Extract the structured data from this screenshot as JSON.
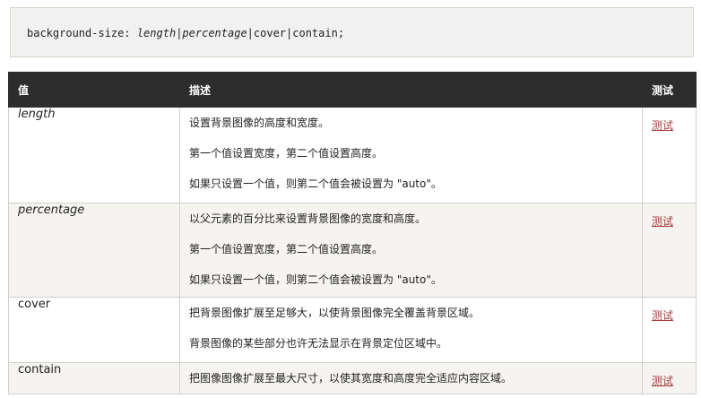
{
  "code": {
    "prefix": "background-size: ",
    "opt1": "length",
    "sep1": "|",
    "opt2": "percentage",
    "rest": "|cover|contain;"
  },
  "table": {
    "headers": [
      "值",
      "描述",
      "测试"
    ],
    "rows": [
      {
        "value": "length",
        "desc": [
          "设置背景图像的高度和宽度。",
          "第一个值设置宽度，第二个值设置高度。",
          "如果只设置一个值，则第二个值会被设置为 \"auto\"。"
        ],
        "test": "测试"
      },
      {
        "value": "percentage",
        "desc": [
          "以父元素的百分比来设置背景图像的宽度和高度。",
          "第一个值设置宽度，第二个值设置高度。",
          "如果只设置一个值，则第二个值会被设置为 \"auto\"。"
        ],
        "test": "测试"
      },
      {
        "value": "cover",
        "desc": [
          "把背景图像扩展至足够大，以使背景图像完全覆盖背景区域。",
          "背景图像的某些部分也许无法显示在背景定位区域中。"
        ],
        "test": "测试"
      },
      {
        "value": "contain",
        "desc": [
          "把图像图像扩展至最大尺寸，以使其宽度和高度完全适应内容区域。"
        ],
        "test": "测试"
      }
    ]
  }
}
